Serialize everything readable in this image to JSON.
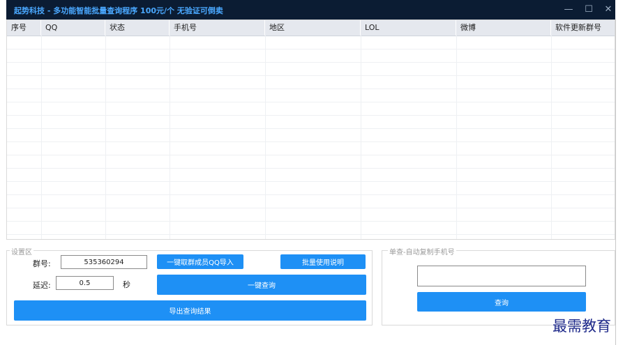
{
  "window": {
    "title": "起势科技 - 多功能智能批量查询程序  100元/个 无验证可倒卖",
    "controls": [
      "—",
      "☐",
      "✕"
    ]
  },
  "grid": {
    "columns": [
      "序号",
      "QQ",
      "状态",
      "手机号",
      "地区",
      "LOL",
      "微博",
      "软件更新群号"
    ],
    "rows": []
  },
  "settings": {
    "group_label": "设置区",
    "group_number_label": "群号:",
    "group_number_value": "535360294",
    "delay_label": "延迟:",
    "delay_value": "0.5",
    "delay_unit": "秒",
    "import_button": "一键取群成员QQ导入",
    "help_button": "批量使用说明",
    "query_button": "一键查询",
    "export_button": "导出查询结果"
  },
  "single": {
    "group_label": "单查-自动复制手机号",
    "input_value": "",
    "query_button": "查询"
  },
  "watermark": "最需教育",
  "colors": {
    "titlebar": "#0b1c33",
    "title_text": "#4aa8ff",
    "button": "#1e90f5",
    "header": "#e5e8ee"
  }
}
